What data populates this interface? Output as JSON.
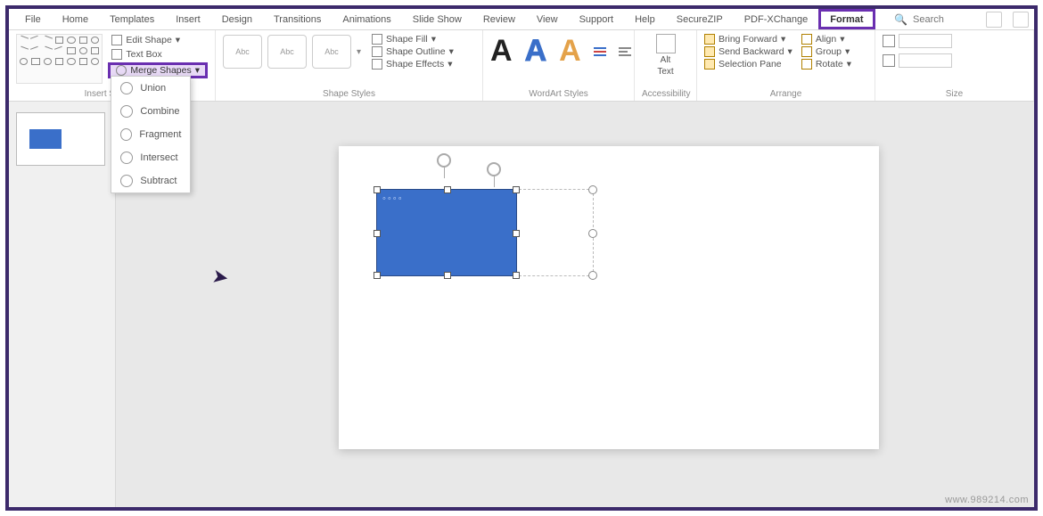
{
  "tabs": {
    "file": "File",
    "home": "Home",
    "templates": "Templates",
    "insert": "Insert",
    "design": "Design",
    "transitions": "Transitions",
    "animations": "Animations",
    "slideshow": "Slide Show",
    "review": "Review",
    "view": "View",
    "support": "Support",
    "help": "Help",
    "securezip": "SecureZIP",
    "pdfxchange": "PDF-XChange",
    "format": "Format"
  },
  "search": {
    "placeholder": "Search"
  },
  "ribbon": {
    "insert_shapes": {
      "label": "Insert Shapes",
      "edit_shape": "Edit Shape",
      "text_box": "Text Box",
      "merge_shapes": "Merge Shapes"
    },
    "merge_menu": {
      "union": "Union",
      "combine": "Combine",
      "fragment": "Fragment",
      "intersect": "Intersect",
      "subtract": "Subtract"
    },
    "shape_styles": {
      "label": "Shape Styles",
      "swatch": "Abc",
      "fill": "Shape Fill",
      "outline": "Shape Outline",
      "effects": "Shape Effects"
    },
    "wordart": {
      "label": "WordArt Styles",
      "letter": "A"
    },
    "accessibility": {
      "label": "Accessibility",
      "alt": "Alt",
      "text": "Text"
    },
    "arrange": {
      "label": "Arrange",
      "bring_forward": "Bring Forward",
      "send_backward": "Send Backward",
      "selection_pane": "Selection Pane",
      "align": "Align",
      "group": "Group",
      "rotate": "Rotate"
    },
    "size": {
      "label": "Size"
    }
  },
  "watermark": "www.989214.com"
}
